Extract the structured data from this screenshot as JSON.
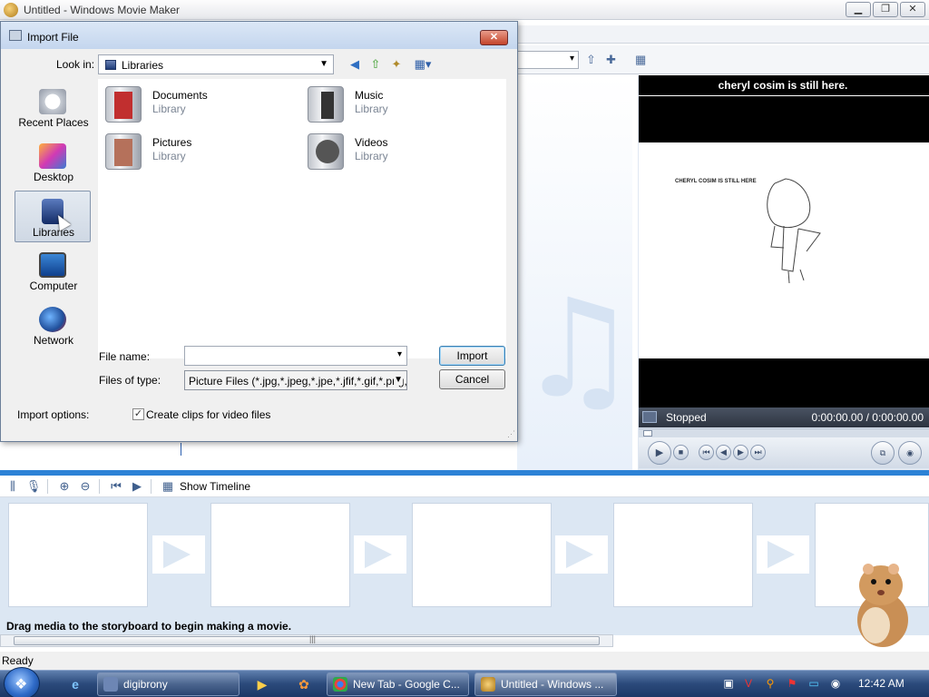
{
  "window": {
    "title": "Untitled - Windows Movie Maker",
    "minimize": "▁",
    "maximize": "❐",
    "close": "✕"
  },
  "monitor": {
    "title": "cheryl cosim is still here.",
    "frame_caption": "CHERYL COSIM IS STILL HERE",
    "status": "Stopped",
    "time": "0:00:00.00 / 0:00:00.00"
  },
  "storyboard": {
    "show_timeline_label": "Show Timeline",
    "hint": "Drag media to the storyboard to begin making a movie."
  },
  "status_bar": {
    "text": "Ready"
  },
  "dialog": {
    "title": "Import File",
    "close": "✕",
    "look_in_label": "Look in:",
    "look_in_value": "Libraries",
    "places": [
      {
        "label": "Recent Places",
        "icon": "recent-places-icon"
      },
      {
        "label": "Desktop",
        "icon": "desktop-icon"
      },
      {
        "label": "Libraries",
        "icon": "libraries-icon"
      },
      {
        "label": "Computer",
        "icon": "computer-icon"
      },
      {
        "label": "Network",
        "icon": "network-icon"
      }
    ],
    "libraries": [
      {
        "name": "Documents",
        "type": "Library"
      },
      {
        "name": "Music",
        "type": "Library"
      },
      {
        "name": "Pictures",
        "type": "Library"
      },
      {
        "name": "Videos",
        "type": "Library"
      }
    ],
    "file_name_label": "File name:",
    "file_name_value": "",
    "files_of_type_label": "Files of type:",
    "files_of_type_value": "Picture Files (*.jpg,*.jpeg,*.jpe,*.jfif,*.gif,*.png,*.b",
    "import_button": "Import",
    "cancel_button": "Cancel",
    "import_options_label": "Import options:",
    "create_clips_label": "Create clips for video files",
    "create_clips_checked": true
  },
  "taskbar": {
    "tasks": [
      {
        "label": "digibrony"
      },
      {
        "label": "New Tab - Google C..."
      },
      {
        "label": "Untitled - Windows ..."
      }
    ],
    "clock": "12:42 AM"
  }
}
